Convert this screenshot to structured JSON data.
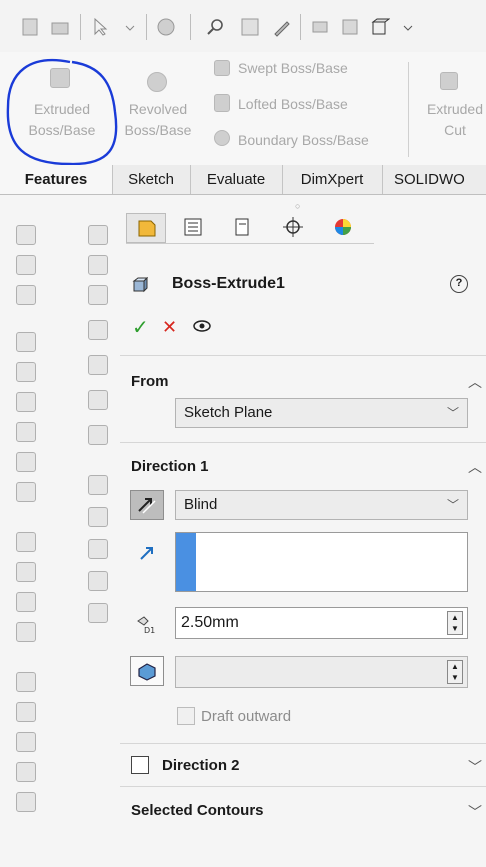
{
  "toolbar": {
    "icons": [
      "new-icon",
      "open-icon",
      "select-icon",
      "rebuild-icon",
      "zoom-icon",
      "zoom-area-icon",
      "sketch-tool-icon",
      "view-icon",
      "display-icon",
      "view-orientation-icon"
    ]
  },
  "ribbon": {
    "extruded_boss": [
      "Extruded",
      "Boss/Base"
    ],
    "revolved_boss": [
      "Revolved",
      "Boss/Base"
    ],
    "swept_boss": "Swept Boss/Base",
    "lofted_boss": "Lofted Boss/Base",
    "boundary_boss": "Boundary Boss/Base",
    "extruded_cut": [
      "Extruded",
      "Cut"
    ]
  },
  "tabs": [
    "Features",
    "Sketch",
    "Evaluate",
    "DimXpert",
    "SOLIDWO"
  ],
  "pm": {
    "title": "Boss-Extrude1",
    "help": "?",
    "from": {
      "label": "From",
      "value": "Sketch Plane"
    },
    "direction1": {
      "label": "Direction 1",
      "type": "Blind",
      "depth": "2.50mm",
      "draft_label": "Draft outward"
    },
    "direction2": {
      "label": "Direction 2"
    },
    "contours": {
      "label": "Selected Contours"
    }
  },
  "colors": {
    "accent_blue": "#4a90e2",
    "highlight": "#1a3bd8",
    "check_green": "#2e9e2e",
    "cross_red": "#d7261e"
  }
}
